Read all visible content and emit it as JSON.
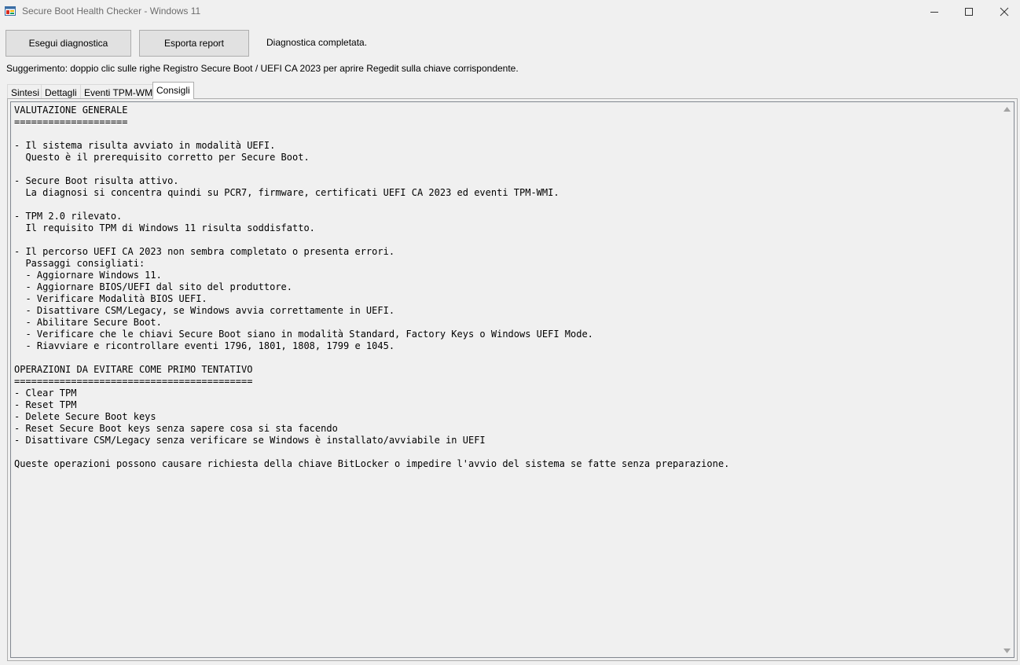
{
  "window": {
    "title": "Secure Boot Health Checker - Windows 11",
    "icons": [
      "app-icon",
      "minimize-icon",
      "maximize-icon",
      "close-icon"
    ]
  },
  "toolbar": {
    "run_label": "Esegui diagnostica",
    "export_label": "Esporta report",
    "status": "Diagnostica completata."
  },
  "hint": "Suggerimento: doppio clic sulle righe Registro Secure Boot / UEFI CA 2023 per aprire Regedit sulla chiave corrispondente.",
  "tabs": [
    {
      "label": "Sintesi",
      "active": false
    },
    {
      "label": "Dettagli",
      "active": false
    },
    {
      "label": "Eventi TPM-WMI",
      "active": false
    },
    {
      "label": "Consigli",
      "active": true
    }
  ],
  "report_text": "VALUTAZIONE GENERALE\n====================\n\n- Il sistema risulta avviato in modalità UEFI.\n  Questo è il prerequisito corretto per Secure Boot.\n\n- Secure Boot risulta attivo.\n  La diagnosi si concentra quindi su PCR7, firmware, certificati UEFI CA 2023 ed eventi TPM-WMI.\n\n- TPM 2.0 rilevato.\n  Il requisito TPM di Windows 11 risulta soddisfatto.\n\n- Il percorso UEFI CA 2023 non sembra completato o presenta errori.\n  Passaggi consigliati:\n  - Aggiornare Windows 11.\n  - Aggiornare BIOS/UEFI dal sito del produttore.\n  - Verificare Modalità BIOS UEFI.\n  - Disattivare CSM/Legacy, se Windows avvia correttamente in UEFI.\n  - Abilitare Secure Boot.\n  - Verificare che le chiavi Secure Boot siano in modalità Standard, Factory Keys o Windows UEFI Mode.\n  - Riavviare e ricontrollare eventi 1796, 1801, 1808, 1799 e 1045.\n\nOPERAZIONI DA EVITARE COME PRIMO TENTATIVO\n==========================================\n- Clear TPM\n- Reset TPM\n- Delete Secure Boot keys\n- Reset Secure Boot keys senza sapere cosa si sta facendo\n- Disattivare CSM/Legacy senza verificare se Windows è installato/avviabile in UEFI\n\nQueste operazioni possono causare richiesta della chiave BitLocker o impedire l'avvio del sistema se fatte senza preparazione."
}
